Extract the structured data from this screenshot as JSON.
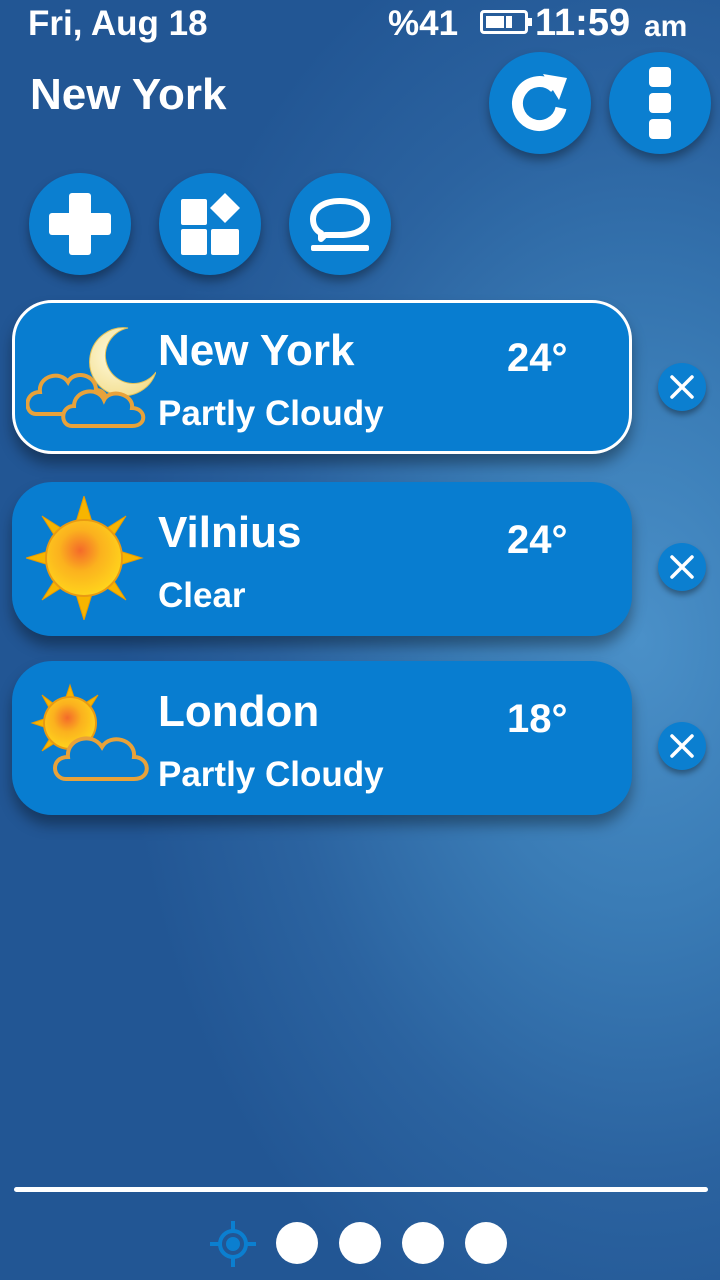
{
  "status_bar": {
    "date": "Fri, Aug 18",
    "battery_percent": "%41",
    "time": "11:59",
    "ampm": "am"
  },
  "header": {
    "city": "New York"
  },
  "toolbar": {
    "refresh_icon": "refresh-icon",
    "menu_icon": "more-vertical-icon",
    "add_icon": "plus-icon",
    "widgets_icon": "widgets-icon",
    "chat_icon": "speech-bubble-icon"
  },
  "locations": [
    {
      "name": "New York",
      "condition": "Partly Cloudy",
      "temp": "24°",
      "icon": "moon-cloud-icon",
      "selected": true
    },
    {
      "name": "Vilnius",
      "condition": "Clear",
      "temp": "24°",
      "icon": "sun-icon",
      "selected": false
    },
    {
      "name": "London",
      "condition": "Partly Cloudy",
      "temp": "18°",
      "icon": "sun-cloud-icon",
      "selected": false
    }
  ],
  "pager": {
    "current_icon": "location-crosshair-icon",
    "pages": 5,
    "current_page": 1
  },
  "colors": {
    "accent": "#087dd0",
    "background": "#2b63a0",
    "sun": "#f7b500",
    "cloud_outline": "#e8a23a"
  }
}
